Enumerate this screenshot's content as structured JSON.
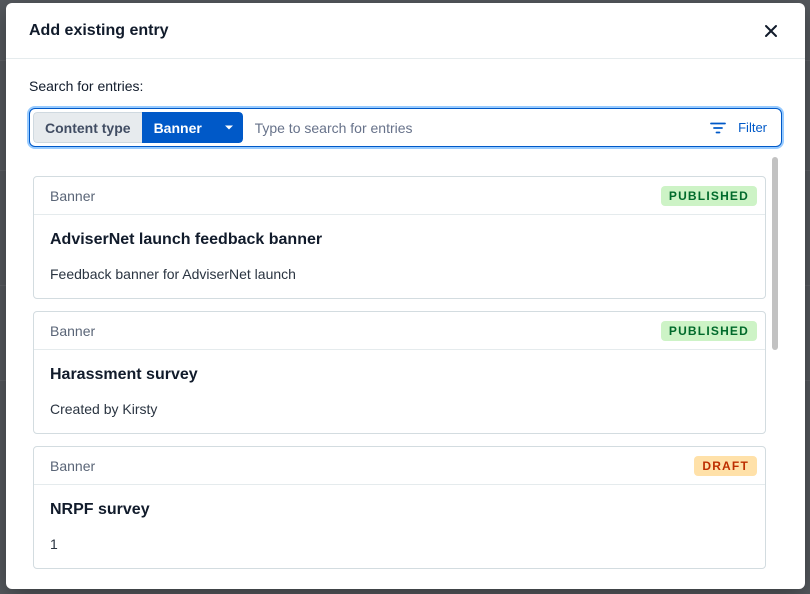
{
  "modal": {
    "title": "Add existing entry",
    "close_icon": "close-icon"
  },
  "search": {
    "label": "Search for entries:",
    "content_type_label": "Content type",
    "content_type_value": "Banner",
    "placeholder": "Type to search for entries",
    "filter_label": "Filter"
  },
  "colors": {
    "accent": "#0059c8",
    "published_bg": "#cdf3c6",
    "published_fg": "#006a2b",
    "draft_bg": "#ffe1a9",
    "draft_fg": "#bd2e00"
  },
  "entries": [
    {
      "type": "Banner",
      "status": "PUBLISHED",
      "title": "AdviserNet launch feedback banner",
      "description": "Feedback banner for AdviserNet launch"
    },
    {
      "type": "Banner",
      "status": "PUBLISHED",
      "title": "Harassment survey",
      "description": "Created by Kirsty"
    },
    {
      "type": "Banner",
      "status": "DRAFT",
      "title": "NRPF survey",
      "description": "1"
    }
  ]
}
